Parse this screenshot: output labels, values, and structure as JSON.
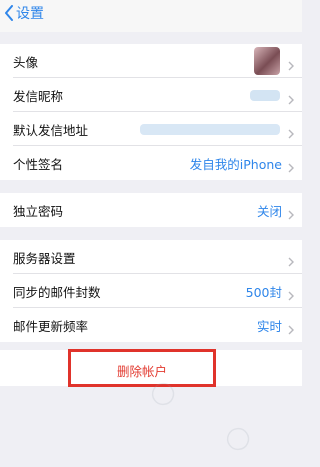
{
  "nav": {
    "back_label": "设置"
  },
  "profile": {
    "avatar_label": "头像",
    "nickname_label": "发信昵称",
    "default_address_label": "默认发信地址",
    "signature_label": "个性签名",
    "signature_value": "发自我的iPhone"
  },
  "security": {
    "password_label": "独立密码",
    "password_value": "关闭"
  },
  "server": {
    "settings_label": "服务器设置",
    "sync_count_label": "同步的邮件封数",
    "sync_count_value": "500封",
    "update_freq_label": "邮件更新频率",
    "update_freq_value": "实时"
  },
  "actions": {
    "delete_account_label": "删除帐户"
  },
  "colors": {
    "accent": "#2f86ea",
    "destructive": "#e23a30",
    "highlight_frame": "#e0332b",
    "background": "#efeff4"
  }
}
